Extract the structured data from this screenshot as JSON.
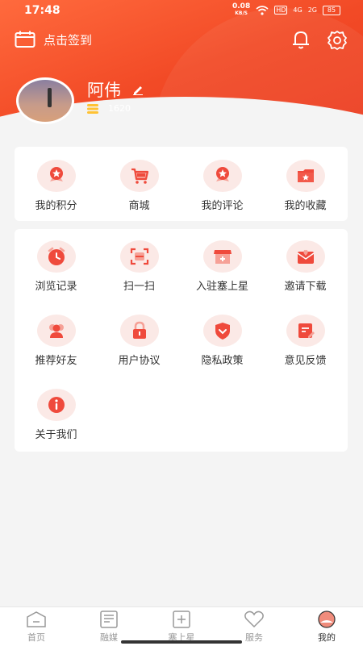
{
  "status": {
    "time": "17:48",
    "speed": "0.08",
    "speed_unit": "KB/S",
    "hd": "HD",
    "net1": "4G",
    "net2": "2G",
    "battery": "85"
  },
  "header": {
    "checkin_label": "点击签到"
  },
  "user": {
    "name": "阿伟",
    "coins": "1620"
  },
  "quick": [
    {
      "label": "我的积分",
      "icon": "medal-icon"
    },
    {
      "label": "商城",
      "icon": "cart-icon"
    },
    {
      "label": "我的评论",
      "icon": "medal-icon"
    },
    {
      "label": "我的收藏",
      "icon": "folder-star-icon"
    }
  ],
  "services": [
    {
      "label": "浏览记录",
      "icon": "clock-icon"
    },
    {
      "label": "扫一扫",
      "icon": "scan-icon"
    },
    {
      "label": "入驻塞上星",
      "icon": "shop-icon"
    },
    {
      "label": "邀请下载",
      "icon": "mail-heart-icon"
    },
    {
      "label": "推荐好友",
      "icon": "friends-icon"
    },
    {
      "label": "用户协议",
      "icon": "lock-icon"
    },
    {
      "label": "隐私政策",
      "icon": "shield-icon"
    },
    {
      "label": "意见反馈",
      "icon": "feedback-icon"
    },
    {
      "label": "关于我们",
      "icon": "info-icon"
    }
  ],
  "tabs": [
    {
      "label": "首页"
    },
    {
      "label": "融媒"
    },
    {
      "label": "塞上星"
    },
    {
      "label": "服务"
    },
    {
      "label": "我的"
    }
  ],
  "colors": {
    "accent": "#f24a26",
    "icon_bg": "#fbe9e6",
    "icon_red": "#ef4a3c"
  }
}
